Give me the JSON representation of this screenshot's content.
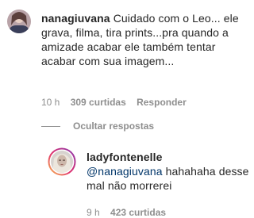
{
  "comment": {
    "username": "nanagiuvana",
    "text": "Cuidado com o Leo... ele grava, filma, tira prints...pra quando a amizade acabar ele também tentar acabar com sua imagem...",
    "time": "10 h",
    "likes": "309 curtidas",
    "reply_label": "Responder"
  },
  "replies_toggle": {
    "label": "Ocultar respostas"
  },
  "reply": {
    "username": "ladyfontenelle",
    "mention": "@nanagiuvana",
    "text": "hahahaha desse mal não morrerei",
    "time": "9 h",
    "likes": "423 curtidas"
  }
}
